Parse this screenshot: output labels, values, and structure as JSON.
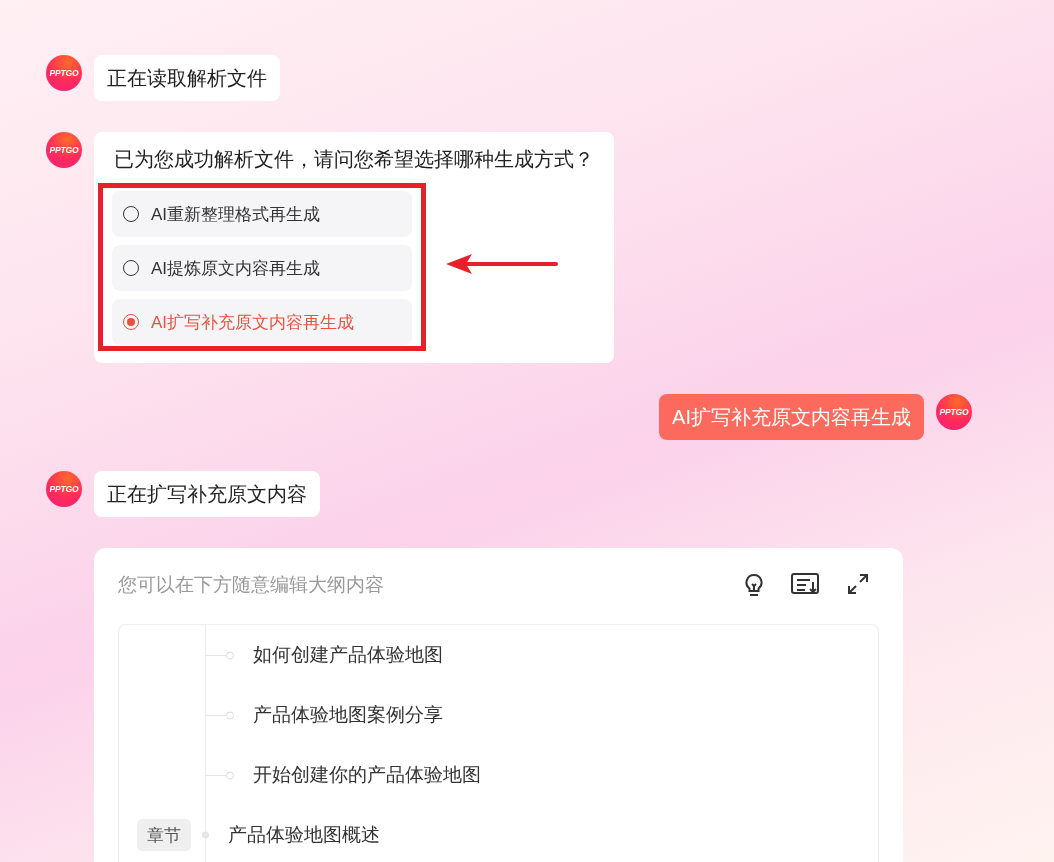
{
  "messages": [
    {
      "kind": "bot_status",
      "avatar": "PPTGO",
      "text": "正在读取解析文件"
    },
    {
      "kind": "choice",
      "avatar": "PPTGO",
      "text": "已为您成功解析文件，请问您希望选择哪种生成方式？",
      "options": [
        {
          "label": "AI重新整理格式再生成",
          "selected": false
        },
        {
          "label": "AI提炼原文内容再生成",
          "selected": false
        },
        {
          "label": "AI扩写补充原文内容再生成",
          "selected": true
        }
      ]
    },
    {
      "kind": "user_status",
      "avatar": "PPTGO",
      "text": "AI扩写补充原文内容再生成"
    },
    {
      "kind": "bot_status",
      "avatar": "PPTGO",
      "text": "正在扩写补充原文内容"
    }
  ],
  "outline": {
    "title": "您可以在下方随意编辑大纲内容",
    "items": [
      {
        "kind": "point",
        "text": "如何创建产品体验地图"
      },
      {
        "kind": "point",
        "text": "产品体验地图案例分享"
      },
      {
        "kind": "point",
        "text": "开始创建你的产品体验地图"
      },
      {
        "kind": "chapter",
        "badge": "章节",
        "text": "产品体验地图概述"
      }
    ]
  }
}
